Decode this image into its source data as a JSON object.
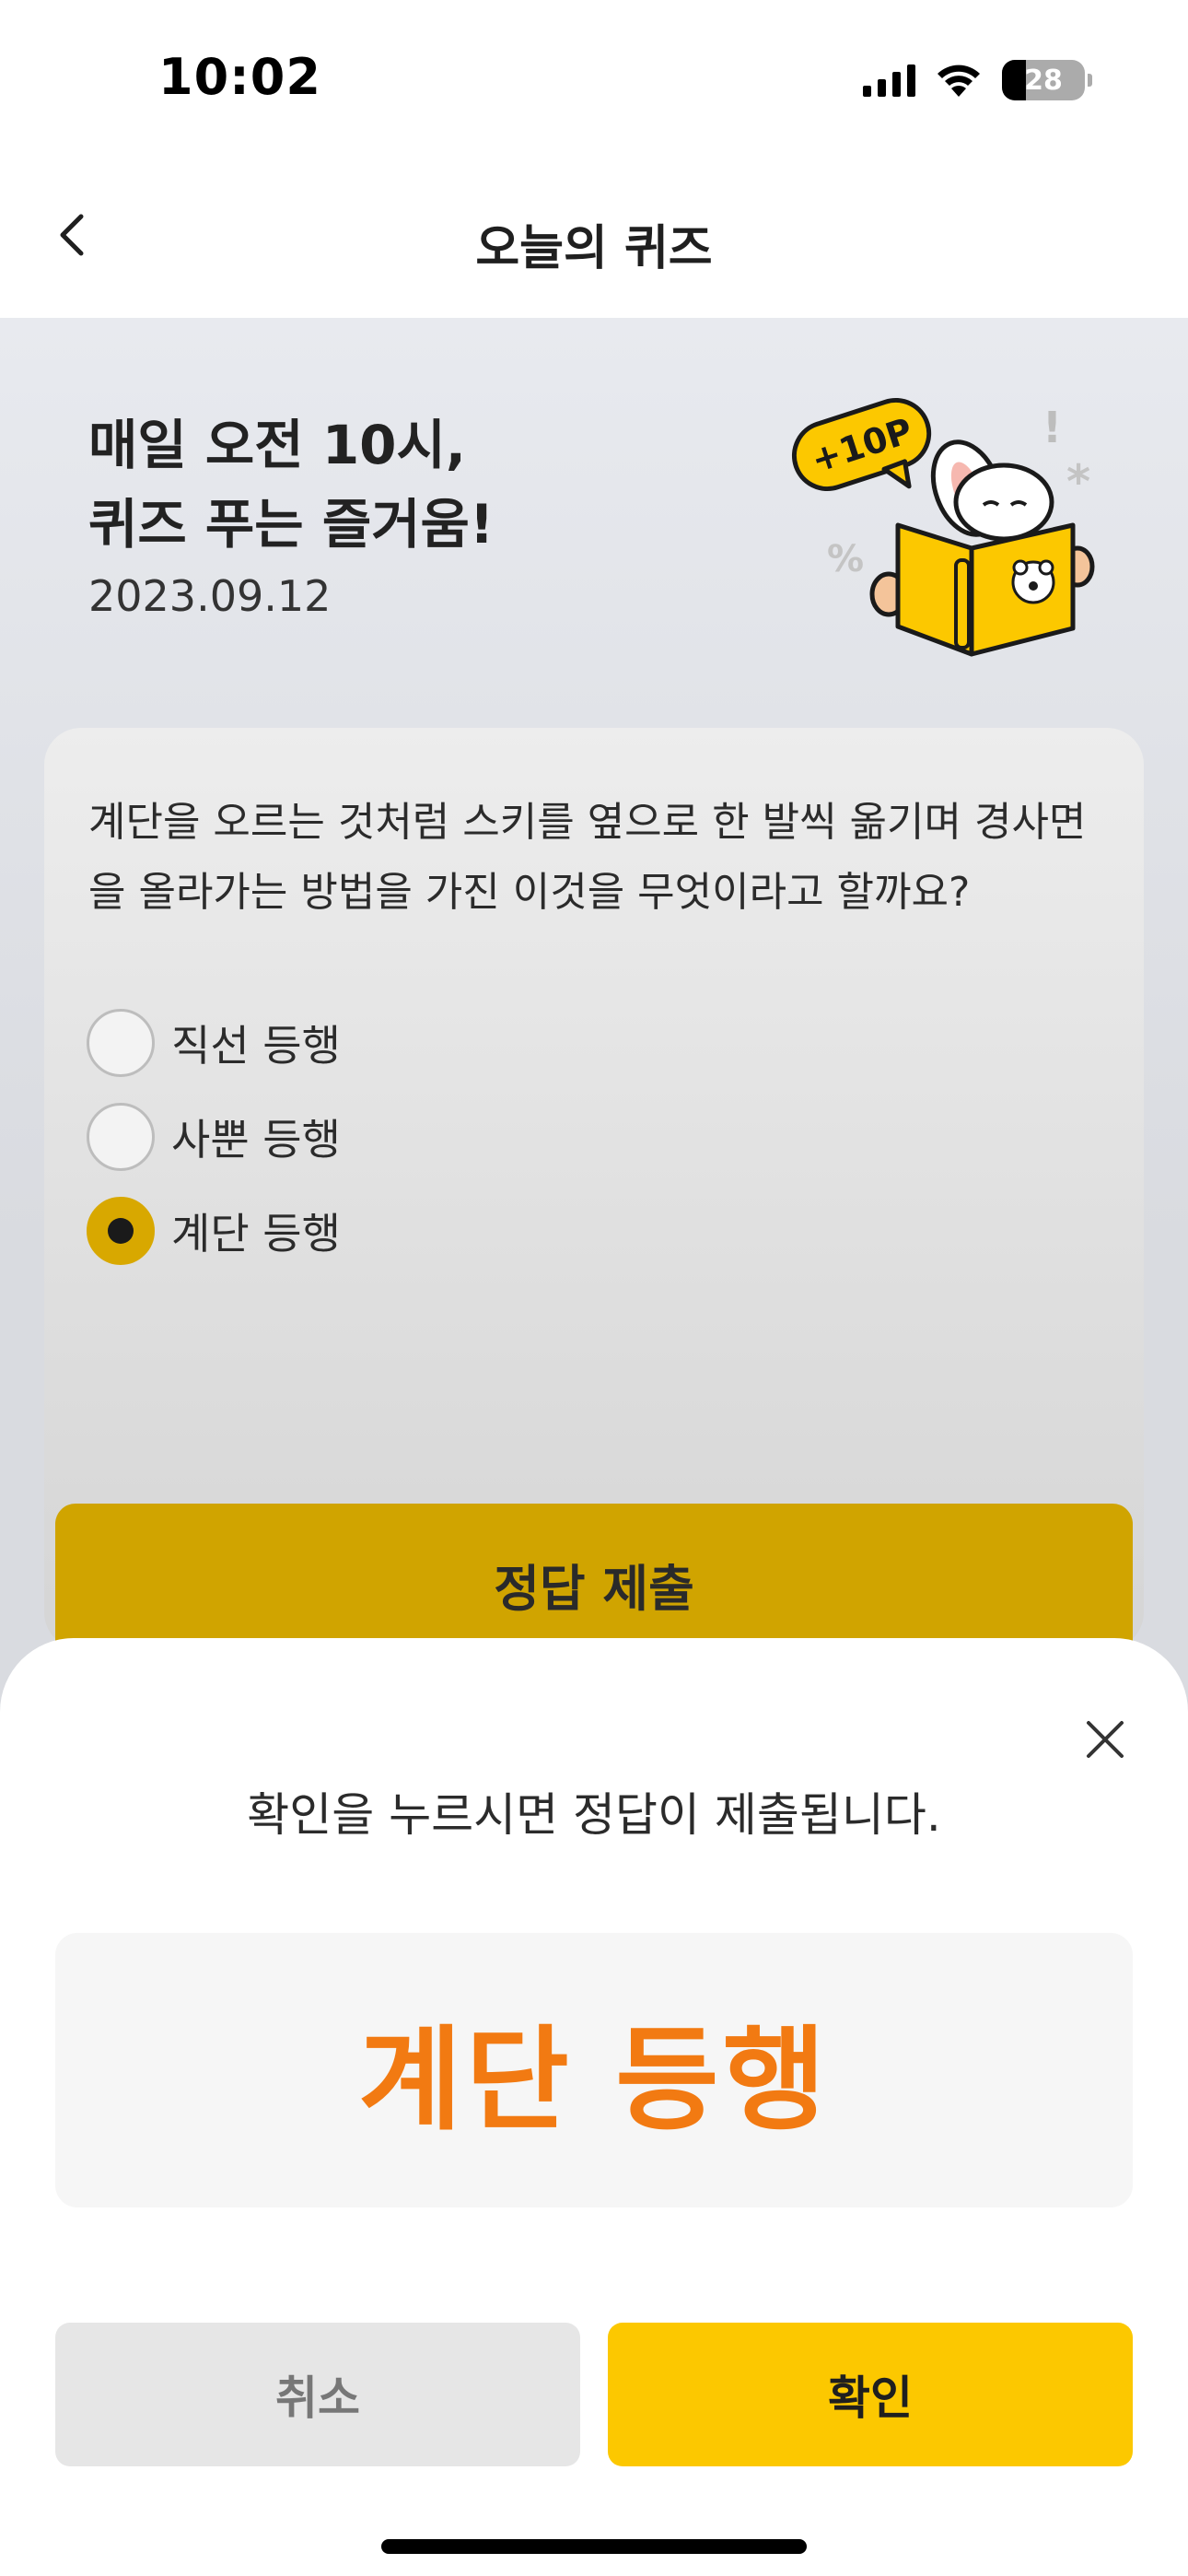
{
  "status_bar": {
    "time": "10:02",
    "battery": "28"
  },
  "header": {
    "title": "오늘의 퀴즈"
  },
  "hero": {
    "title_line1": "매일 오전 10시,",
    "title_line2": "퀴즈 푸는 즐거움!",
    "date": "2023.09.12",
    "badge": "+10P"
  },
  "quiz": {
    "question": "계단을 오르는 것처럼 스키를 옆으로 한 발씩 옮기며 경사면을 올라가는 방법을 가진 이것을 무엇이라고 할까요?",
    "options": [
      {
        "label": "직선 등행",
        "selected": false
      },
      {
        "label": "사뿐 등행",
        "selected": false
      },
      {
        "label": "계단 등행",
        "selected": true
      }
    ],
    "submit_label": "정답 제출"
  },
  "sheet": {
    "message": "확인을 누르시면 정답이 제출됩니다.",
    "answer": "계단 등행",
    "cancel_label": "취소",
    "confirm_label": "확인"
  },
  "colors": {
    "accent": "#fcc800",
    "answer": "#f27a12"
  }
}
